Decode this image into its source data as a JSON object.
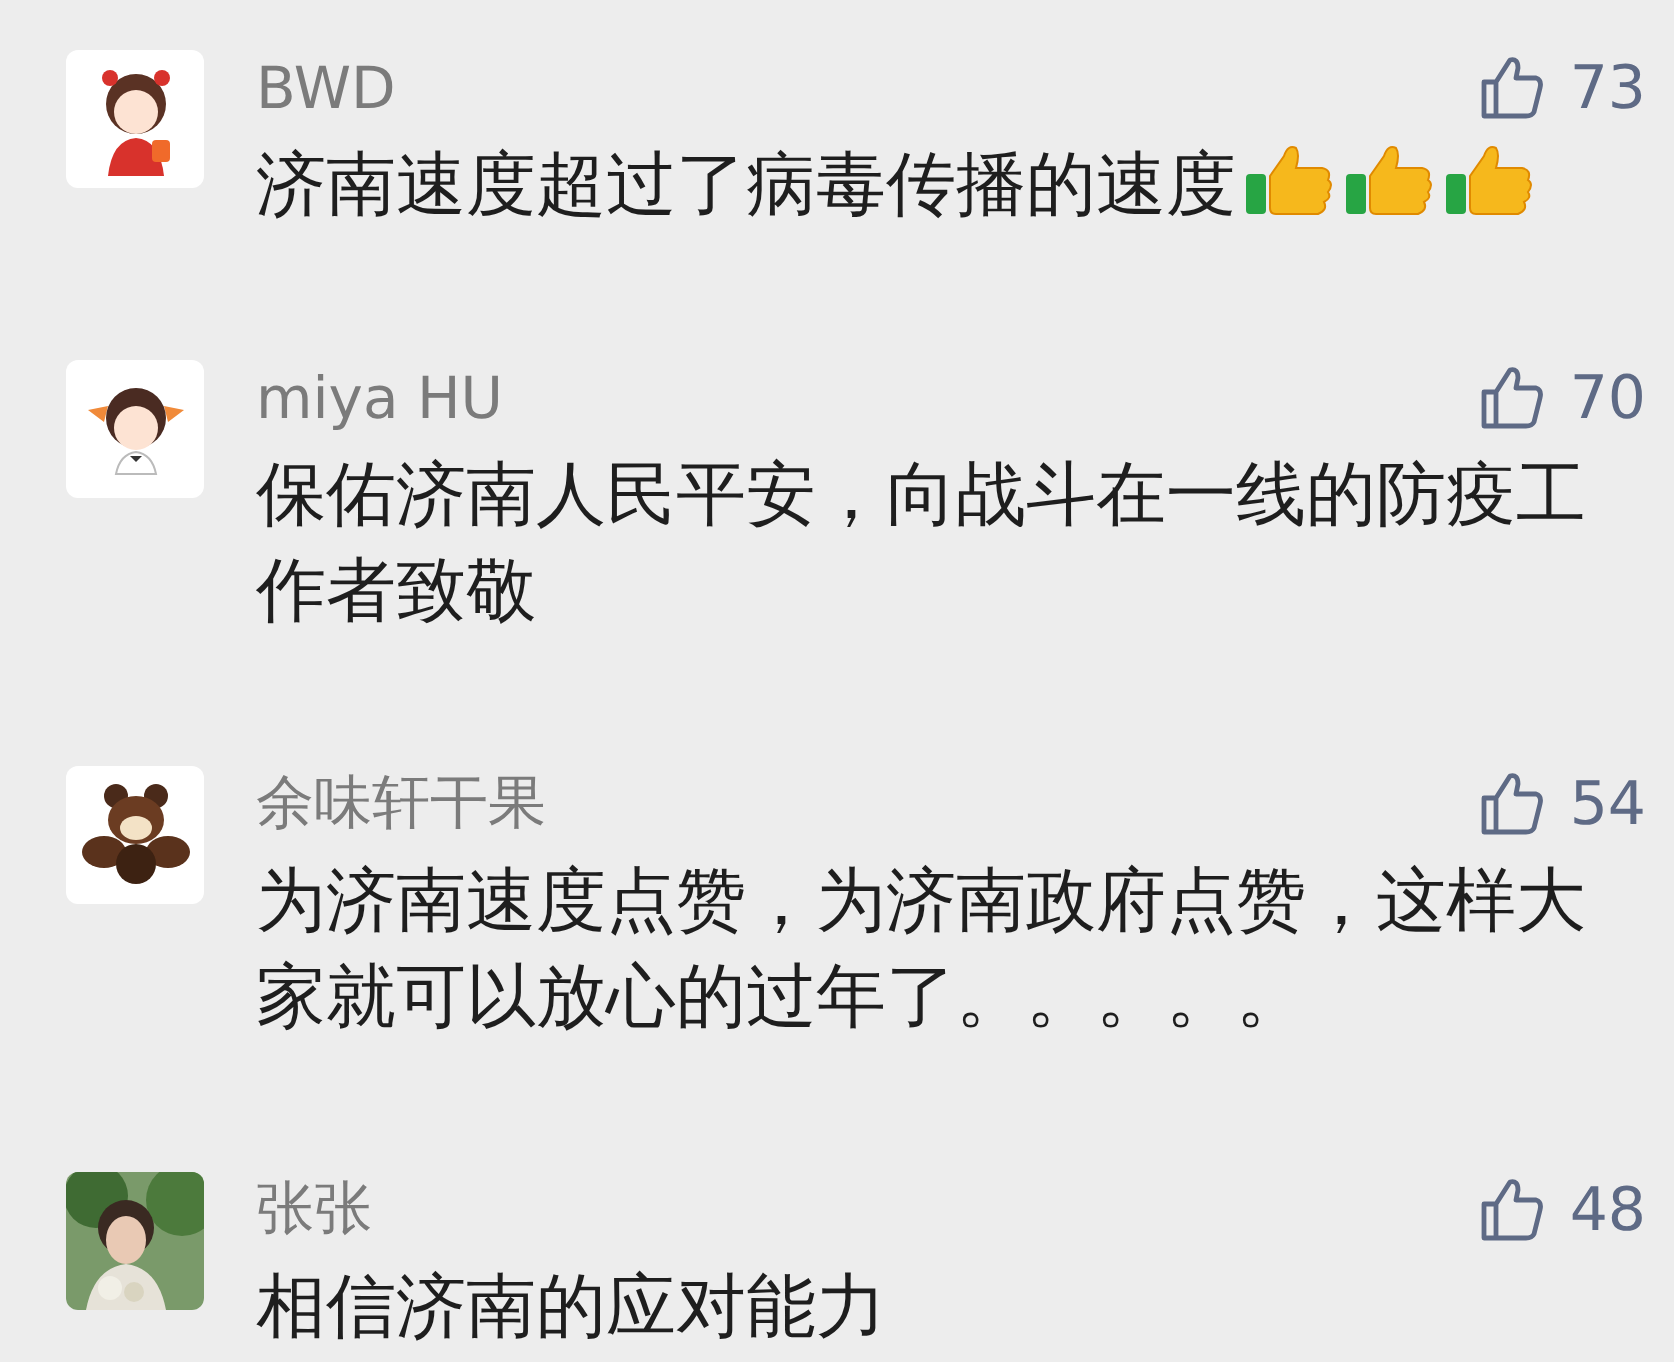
{
  "comments": [
    {
      "avatar": {
        "kind": "girl"
      },
      "name": "BWD",
      "text": "济南速度超过了病毒传播的速度",
      "emojis": [
        {
          "kind": "thumbs_up"
        },
        {
          "kind": "thumbs_up"
        },
        {
          "kind": "thumbs_up"
        }
      ],
      "likes": "73"
    },
    {
      "avatar": {
        "kind": "boy"
      },
      "name": "miya HU",
      "text": "保佑济南人民平安，向战斗在一线的防疫工作者致敬",
      "likes": "70"
    },
    {
      "avatar": {
        "kind": "squirrel"
      },
      "name": "余味轩干果",
      "text": "为济南速度点赞，为济南政府点赞，这样大家就可以放心的过年了。。。。。",
      "likes": "54"
    },
    {
      "name": "张张",
      "text": "相信济南的应对能力",
      "likes": "48"
    }
  ]
}
